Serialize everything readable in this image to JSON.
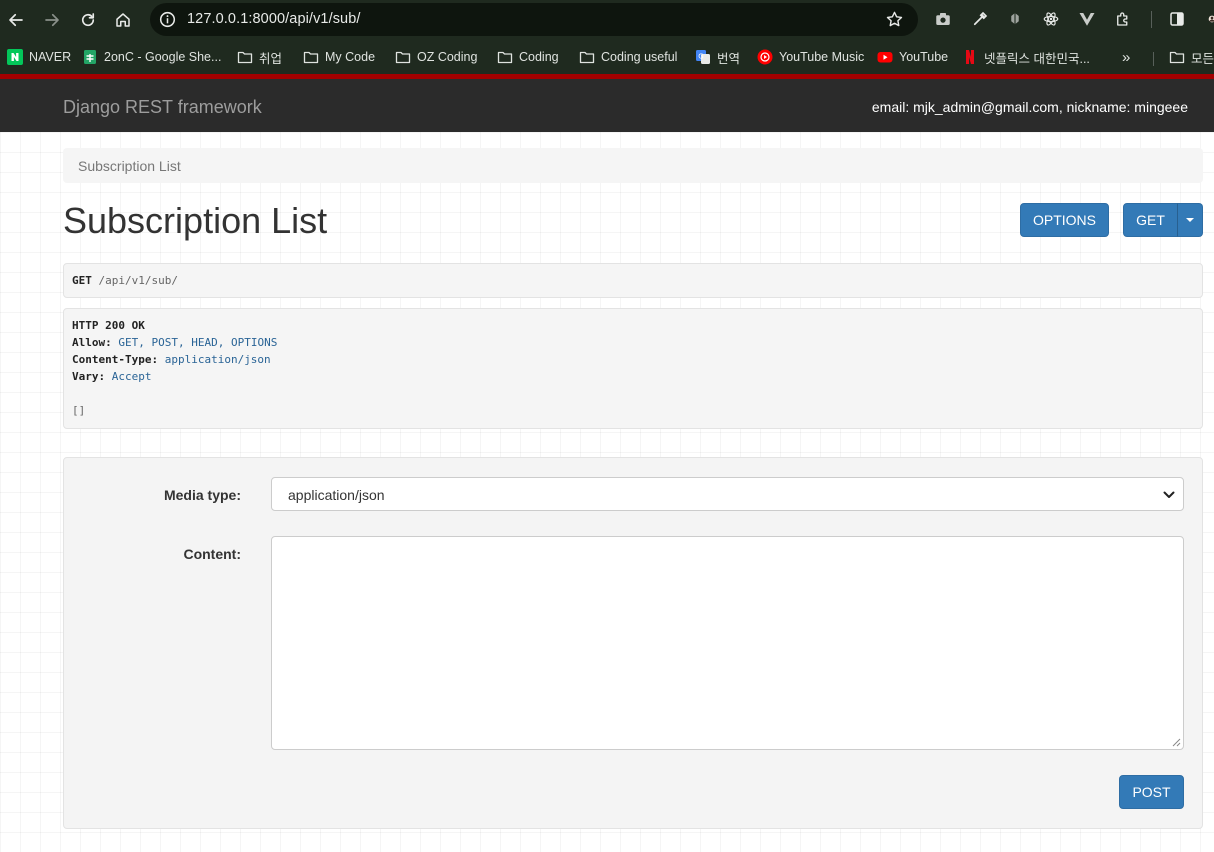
{
  "browser": {
    "url": "127.0.0.1:8000/api/v1/sub/",
    "bookmarks": [
      {
        "label": "NAVER",
        "icon": "naver-icon"
      },
      {
        "label": "2onC - Google She...",
        "icon": "google-sheets-icon"
      },
      {
        "label": "취업",
        "icon": "folder-icon"
      },
      {
        "label": "My Code",
        "icon": "folder-icon"
      },
      {
        "label": "OZ Coding",
        "icon": "folder-icon"
      },
      {
        "label": "Coding",
        "icon": "folder-icon"
      },
      {
        "label": "Coding useful",
        "icon": "folder-icon"
      },
      {
        "label": "번역",
        "icon": "google-translate-icon"
      },
      {
        "label": "YouTube Music",
        "icon": "youtube-music-icon"
      },
      {
        "label": "YouTube",
        "icon": "youtube-icon"
      },
      {
        "label": "넷플릭스 대한민국...",
        "icon": "netflix-icon"
      },
      {
        "label": "모든",
        "icon": "folder-icon"
      }
    ],
    "overflow_glyph": "»"
  },
  "navbar": {
    "brand": "Django REST framework",
    "user_info": "email: mjk_admin@gmail.com, nickname: mingeee"
  },
  "breadcrumb": "Subscription List",
  "page_title": "Subscription List",
  "buttons": {
    "options": "OPTIONS",
    "get": "GET",
    "post": "POST"
  },
  "request": {
    "method": "GET",
    "path": "/api/v1/sub/"
  },
  "response": {
    "status": "HTTP 200 OK",
    "headers": [
      {
        "key": "Allow:",
        "value": "GET, POST, HEAD, OPTIONS"
      },
      {
        "key": "Content-Type:",
        "value": "application/json"
      },
      {
        "key": "Vary:",
        "value": "Accept"
      }
    ],
    "body": "[]"
  },
  "form": {
    "media_type_label": "Media type:",
    "media_type_value": "application/json",
    "content_label": "Content:",
    "content_value": ""
  },
  "colors": {
    "primary": "#337ab7",
    "navbar": "#2b2b2b",
    "accent_line": "#a30000",
    "chrome": "#1f2a1f"
  }
}
